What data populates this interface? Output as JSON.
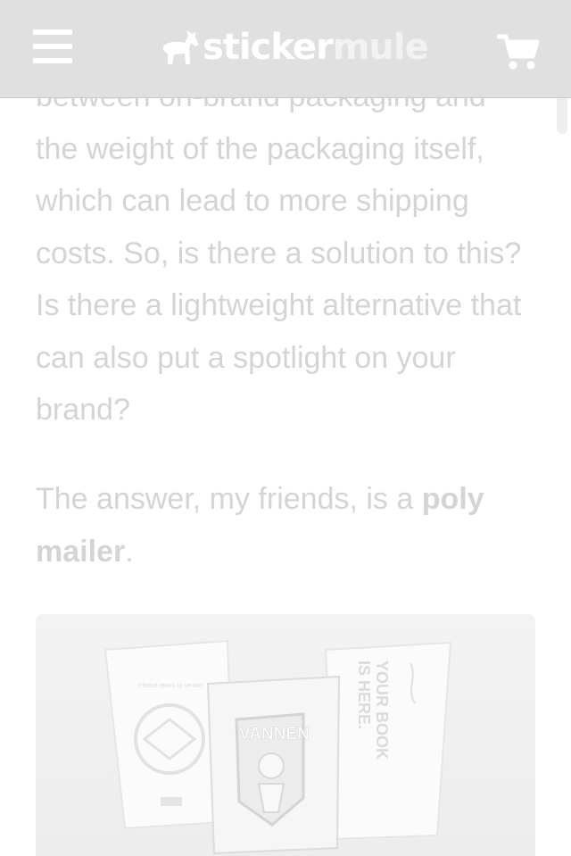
{
  "header": {
    "menu_icon": "hamburger-menu-icon",
    "logo": {
      "part1": "sticker",
      "part2": "mule",
      "mark_icon": "mule-icon"
    },
    "cart_icon": "shopping-cart-icon"
  },
  "article": {
    "paragraph_1": "between on-brand packaging and the weight of the packaging itself, which can lead to more shipping costs. So, is there a solution to this? Is there a lightweight alternative that can also put a spotlight on your brand?",
    "paragraph_2_prefix": "The answer, my friends, is a ",
    "paragraph_2_bold": "poly mailer",
    "paragraph_2_suffix": ".",
    "image": {
      "left_bag_caption": "Please return to sender",
      "center_bag_text": "VANNEN",
      "right_bag_line1": "YOUR BOOK",
      "right_bag_line2": "IS HERE."
    }
  },
  "colors": {
    "header_bg": "#e0e0e0",
    "text": "#d4d4d4",
    "image_bg": "#f1f1f1"
  }
}
